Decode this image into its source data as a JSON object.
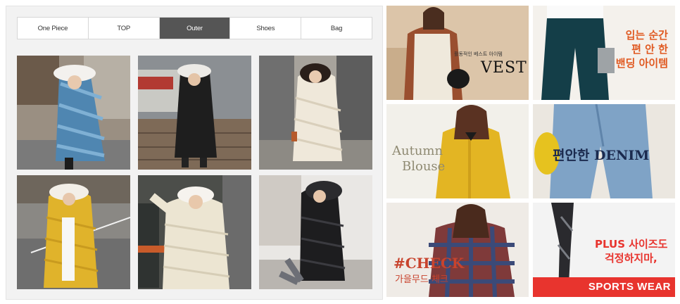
{
  "tabs": [
    {
      "label": "One Piece",
      "active": false
    },
    {
      "label": "TOP",
      "active": false
    },
    {
      "label": "Outer",
      "active": true
    },
    {
      "label": "Shoes",
      "active": false
    },
    {
      "label": "Bag",
      "active": false
    }
  ],
  "products": [
    {
      "icon": "blue-velvet-padded-coat-photo",
      "coat_color": "#4f86b1"
    },
    {
      "icon": "black-long-padded-coat-photo",
      "coat_color": "#1e1e1e"
    },
    {
      "icon": "cream-long-padded-coat-photo",
      "coat_color": "#efe8da"
    },
    {
      "icon": "yellow-quilted-coat-photo",
      "coat_color": "#e0b32b"
    },
    {
      "icon": "cream-puffer-coat-photo",
      "coat_color": "#ece5d2"
    },
    {
      "icon": "black-puffer-coat-photo",
      "coat_color": "#1d1d1f"
    }
  ],
  "banners": {
    "vest": {
      "small": "활동적인 베스트 아이템",
      "big": "VEST"
    },
    "pants": {
      "line1": "입는 순간",
      "line2": "편 안 한",
      "line3": "밴딩 아이템"
    },
    "blouse": {
      "line1": "Autumn",
      "line2": "Blouse"
    },
    "denim": {
      "text": "편안한 DENIM"
    },
    "check": {
      "line1": "#CHECK",
      "line2": "가을무드 체크"
    },
    "sports": {
      "line1": "PLUS 사이즈도",
      "line2": "걱정하지마,",
      "bar": "SPORTS WEAR"
    }
  },
  "colors": {
    "active_tab": "#555555",
    "accent_red": "#e8342e",
    "accent_orange": "#e05a22",
    "denim_navy": "#1b2a4e"
  }
}
